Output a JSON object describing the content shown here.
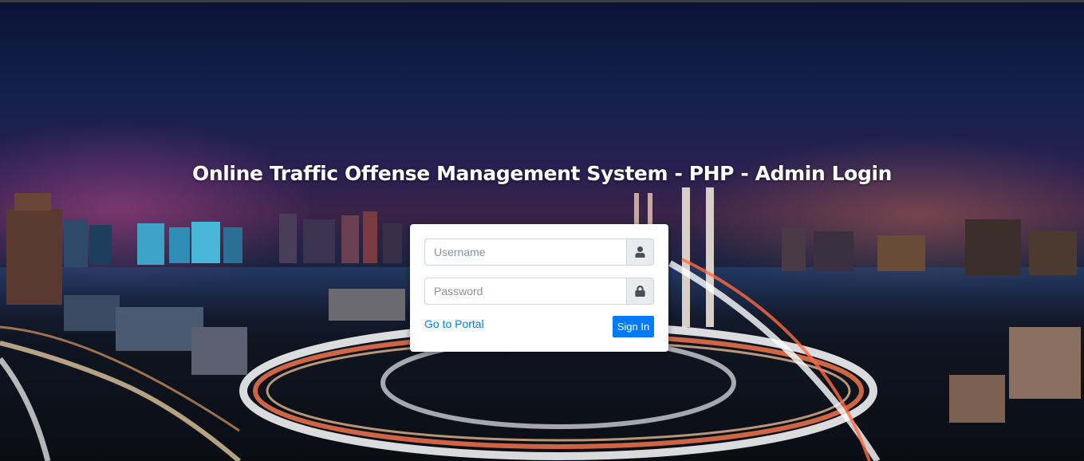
{
  "page": {
    "title": "Online Traffic Offense Management System - PHP - Admin Login"
  },
  "login_form": {
    "username": {
      "placeholder": "Username",
      "value": "",
      "icon": "user-icon"
    },
    "password": {
      "placeholder": "Password",
      "value": "",
      "icon": "lock-icon"
    },
    "portal_link_label": "Go to Portal",
    "signin_label": "Sign In"
  },
  "colors": {
    "primary": "#007bff",
    "addon_bg": "#e9ecef",
    "card_bg": "#ffffff",
    "title_text": "#ffffff"
  }
}
